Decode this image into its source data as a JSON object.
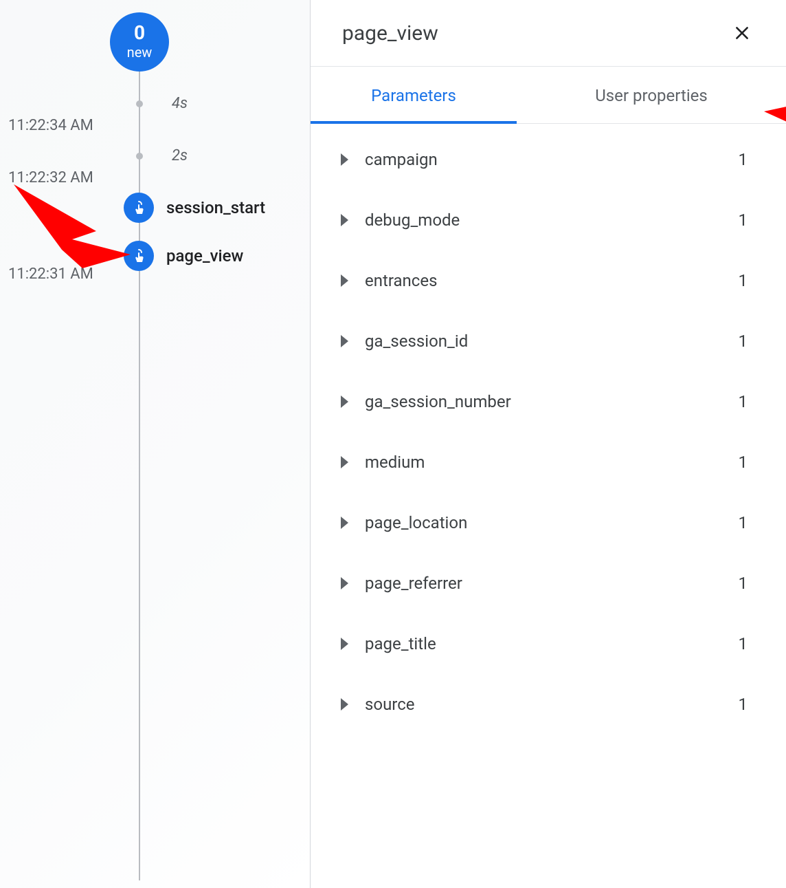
{
  "timeline": {
    "badge_count": "0",
    "badge_label": "new",
    "gap1": "4s",
    "gap2": "2s",
    "ts1": "11:22:34 AM",
    "ts2": "11:22:32 AM",
    "ts3": "11:22:31 AM",
    "events": [
      {
        "name": "session_start"
      },
      {
        "name": "page_view"
      }
    ]
  },
  "detail": {
    "title": "page_view",
    "tabs": {
      "parameters": "Parameters",
      "user_properties": "User properties"
    },
    "parameters": [
      {
        "name": "campaign",
        "count": "1"
      },
      {
        "name": "debug_mode",
        "count": "1"
      },
      {
        "name": "entrances",
        "count": "1"
      },
      {
        "name": "ga_session_id",
        "count": "1"
      },
      {
        "name": "ga_session_number",
        "count": "1"
      },
      {
        "name": "medium",
        "count": "1"
      },
      {
        "name": "page_location",
        "count": "1"
      },
      {
        "name": "page_referrer",
        "count": "1"
      },
      {
        "name": "page_title",
        "count": "1"
      },
      {
        "name": "source",
        "count": "1"
      }
    ]
  }
}
